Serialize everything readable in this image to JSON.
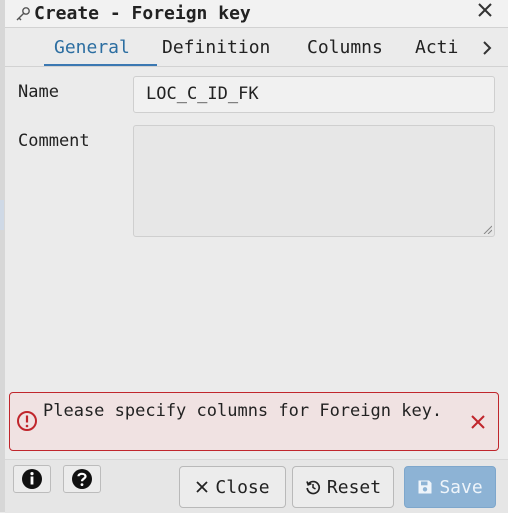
{
  "dialog": {
    "title": "Create - Foreign key"
  },
  "tabs": [
    {
      "label": "General",
      "active": true
    },
    {
      "label": "Definition",
      "active": false
    },
    {
      "label": "Columns",
      "active": false
    },
    {
      "label": "Acti",
      "active": false
    }
  ],
  "form": {
    "name_label": "Name",
    "name_value": "LOC_C_ID_FK",
    "comment_label": "Comment",
    "comment_value": ""
  },
  "alert": {
    "message": "Please specify columns for Foreign key.",
    "color": "#c0262c"
  },
  "footer": {
    "close_label": "Close",
    "reset_label": "Reset",
    "save_label": "Save"
  },
  "icons": {
    "title": "key-icon",
    "window_close": "close-icon",
    "tab_scroll": "chevron-right-icon",
    "alert": "error-circle-icon",
    "alert_close": "close-icon",
    "info": "info-icon",
    "help": "help-icon",
    "close": "close-icon",
    "reset": "reset-icon",
    "save": "save-icon"
  },
  "colors": {
    "accent": "#2c6ea1",
    "save_bg": "#8db3d5",
    "alert_bg": "#f0e2e2"
  }
}
